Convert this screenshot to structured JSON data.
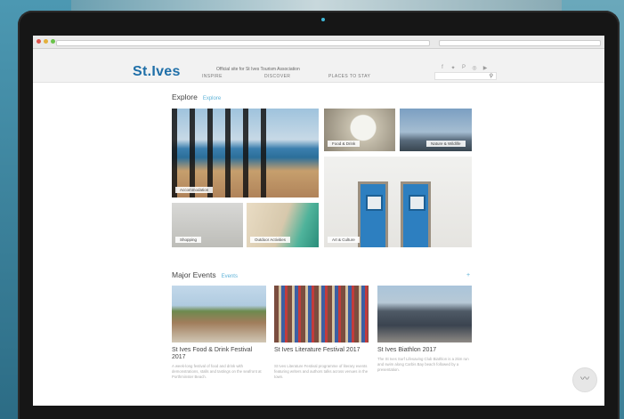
{
  "browser": {
    "address": "",
    "search_placeholder": ""
  },
  "site": {
    "logo": "St.Ives",
    "tagline": "Official site for St Ives Tourism Association",
    "menu": [
      "INSPIRE",
      "DISCOVER",
      "PLACES TO STAY"
    ],
    "social_icons": [
      "facebook-icon",
      "twitter-icon",
      "pinterest-icon",
      "instagram-icon",
      "youtube-icon"
    ],
    "search_placeholder": ""
  },
  "explore": {
    "title": "Explore",
    "link": "Explore",
    "tiles": [
      "Accommodation",
      "Food & Drink",
      "Nature & Wildlife",
      "Shopping",
      "Outdoor Activities",
      "Art & Culture"
    ]
  },
  "events": {
    "title": "Major Events",
    "link": "Events",
    "more": "+",
    "items": [
      {
        "title": "St Ives Food & Drink Festival 2017",
        "desc": "A week-long festival of food and drink with demonstrations, stalls and tastings on the seafront at Porthminster Beach."
      },
      {
        "title": "St Ives Literature Festival 2017",
        "desc": "St Ives Literature Festival programme of literary events featuring writers and authors talks across venues in the town."
      },
      {
        "title": "St Ives Biathlon 2017",
        "desc": "The St Ives Surf Lifesaving Club Biathlon is a 2km run and swim along Carbis Bay beach followed by a presentation."
      }
    ]
  },
  "colors": {
    "accent": "#5fb3d8",
    "logo": "#1f6fa8"
  }
}
